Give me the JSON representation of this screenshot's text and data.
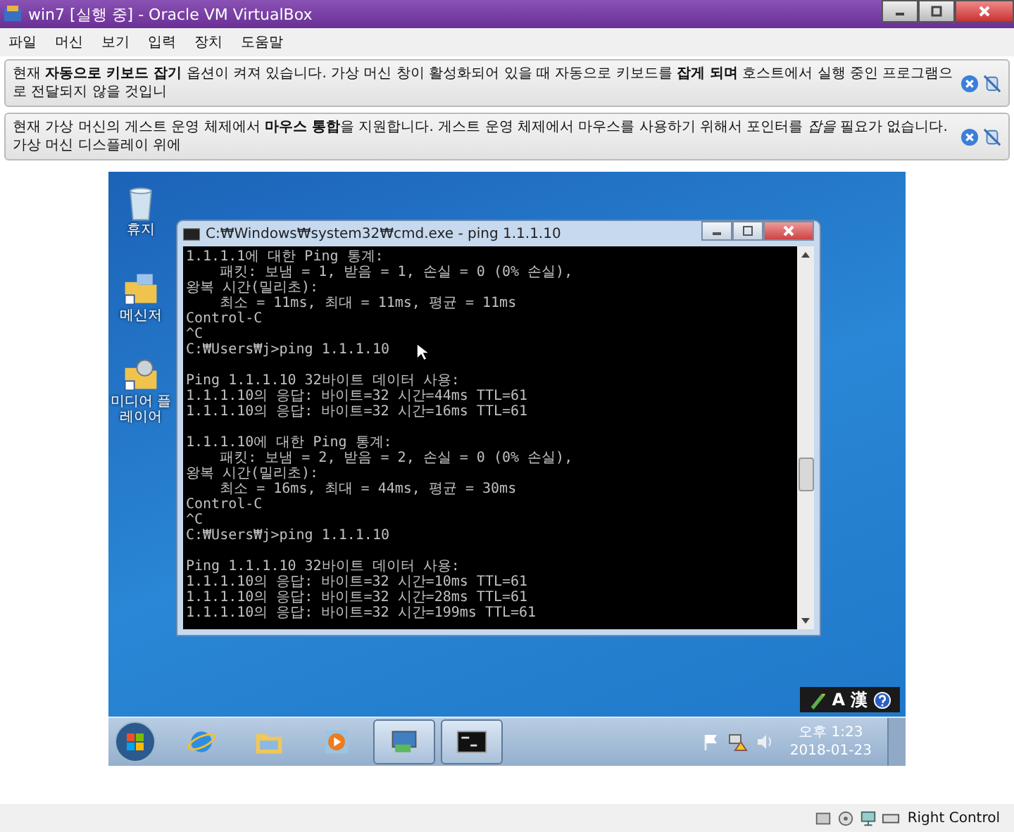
{
  "window": {
    "title": "win7 [실행 중] - Oracle VM VirtualBox"
  },
  "menu": [
    "파일",
    "머신",
    "보기",
    "입력",
    "장치",
    "도움말"
  ],
  "notifications": [
    {
      "text": "현재 **자동으로 키보드 잡기** 옵션이 켜져 있습니다. 가상 머신 창이 활성화되어 있을 때 자동으로 키보드를 **잡게 되며** 호스트에서 실행 중인 프로그램으로 전달되지 않을 것입니"
    },
    {
      "text": "현재 가상 머신의 게스트 운영 체제에서 **마우스 통합**을 지원합니다. 게스트 운영 체제에서 마우스를 사용하기 위해서 포인터를 *잡을* 필요가 없습니다. 가상 머신 디스플레이 위에"
    }
  ],
  "desktop_icons": [
    {
      "kind": "trash",
      "label": "휴지"
    },
    {
      "kind": "messenger",
      "label": "메신저"
    },
    {
      "kind": "media",
      "label": "미디어 플레이어"
    }
  ],
  "console": {
    "title": "C:₩Windows₩system32₩cmd.exe - ping  1.1.1.10",
    "blocks": [
      [
        "1.1.1.1에 대한 Ping 통계:",
        "    패킷: 보냄 = 1, 받음 = 1, 손실 = 0 (0% 손실),",
        "왕복 시간(밀리초):",
        "    최소 = 11ms, 최대 = 11ms, 평균 = 11ms",
        "Control-C",
        "^C",
        "C:₩Users₩j>ping 1.1.1.10"
      ],
      [
        "Ping 1.1.1.10 32바이트 데이터 사용:",
        "1.1.1.10의 응답: 바이트=32 시간=44ms TTL=61",
        "1.1.1.10의 응답: 바이트=32 시간=16ms TTL=61"
      ],
      [
        "1.1.1.10에 대한 Ping 통계:",
        "    패킷: 보냄 = 2, 받음 = 2, 손실 = 0 (0% 손실),",
        "왕복 시간(밀리초):",
        "    최소 = 16ms, 최대 = 44ms, 평균 = 30ms",
        "Control-C",
        "^C",
        "C:₩Users₩j>ping 1.1.1.10"
      ],
      [
        "Ping 1.1.1.10 32바이트 데이터 사용:",
        "1.1.1.10의 응답: 바이트=32 시간=10ms TTL=61",
        "1.1.1.10의 응답: 바이트=32 시간=28ms TTL=61",
        "1.1.1.10의 응답: 바이트=32 시간=199ms TTL=61"
      ]
    ]
  },
  "language_bar": {
    "mode": "A",
    "hanja": "漢"
  },
  "taskbar": {
    "items": [
      {
        "kind": "browser",
        "running": false
      },
      {
        "kind": "folder",
        "running": false
      },
      {
        "kind": "media",
        "running": false
      },
      {
        "kind": "network",
        "running": true
      },
      {
        "kind": "console",
        "running": true
      }
    ],
    "time": "오후 1:23",
    "date": "2018-01-23"
  },
  "status_bar": {
    "host_key": "Right Control"
  }
}
